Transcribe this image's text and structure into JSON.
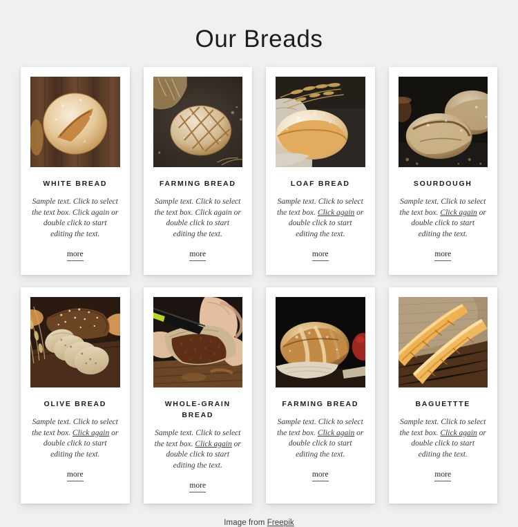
{
  "page": {
    "title": "Our Breads",
    "background_color": "#f0f0f0",
    "card_background_color": "#ffffff",
    "text_color": "#1a1a1a"
  },
  "footer": {
    "prefix": "Image from ",
    "link_label": "Freepik"
  },
  "common": {
    "more_label": "more",
    "desc_part1": "Sample text. Click to select the text box. ",
    "desc_link": "Click again",
    "desc_part2": " or double click to start editing the text."
  },
  "cards": [
    {
      "title": "White Bread",
      "image_name": "white-bread-round-loaf-on-dark-wood",
      "link_underlined": false,
      "desc_part1": "Sample text. Click to select the text box. ",
      "desc_link": "Click again",
      "desc_part2": " or double click to start editing the text.",
      "more_label": "more"
    },
    {
      "title": "Farming Bread",
      "image_name": "farming-bread-scored-loaf-with-burlap-sack",
      "link_underlined": false,
      "desc_part1": "Sample text. Click to select the text box. ",
      "desc_link": "Click again",
      "desc_part2": " or double click to start editing the text.",
      "more_label": "more"
    },
    {
      "title": "Loaf Bread",
      "image_name": "loaf-bread-with-wheat-ears-on-dark-slate",
      "link_underlined": true,
      "desc_part1": "Sample text. Click to select the text box. ",
      "desc_link": "Click again",
      "desc_part2": " or double click to start editing the text.",
      "more_label": "more"
    },
    {
      "title": "Sourdough",
      "image_name": "sourdough-rustic-loaves-on-black-background",
      "link_underlined": true,
      "desc_part1": "Sample text. Click to select the text box. ",
      "desc_link": "Click again",
      "desc_part2": " or double click to start editing the text.",
      "more_label": "more"
    },
    {
      "title": "Olive Bread",
      "image_name": "olive-bread-sliced-seeded-loaf-on-board",
      "link_underlined": true,
      "desc_part1": "Sample text. Click to select the text box. ",
      "desc_link": "Click again",
      "desc_part2": " or double click to start editing the text.",
      "more_label": "more"
    },
    {
      "title": "Whole-grain Bread",
      "image_name": "whole-grain-bread-being-sliced-with-knife",
      "link_underlined": true,
      "desc_part1": "Sample text. Click to select the text box. ",
      "desc_link": "Click again",
      "desc_part2": " or double click to start editing the text.",
      "more_label": "more"
    },
    {
      "title": "Farming Bread",
      "image_name": "farming-bread-round-loaf-on-wooden-board",
      "link_underlined": true,
      "desc_part1": "Sample text. Click to select the text box. ",
      "desc_link": "Click again",
      "desc_part2": " or double click to start editing the text.",
      "more_label": "more"
    },
    {
      "title": "Baguettte",
      "image_name": "baguettes-on-burlap-and-wooden-table",
      "link_underlined": true,
      "desc_part1": "Sample text. Click to select the text box. ",
      "desc_link": "Click again",
      "desc_part2": " or double click to start editing the text.",
      "more_label": "more"
    }
  ]
}
